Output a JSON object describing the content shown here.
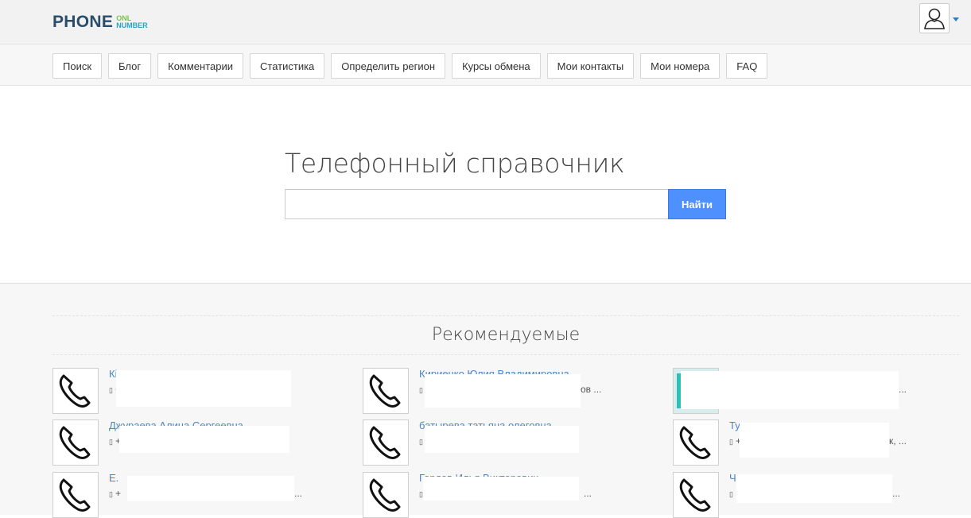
{
  "header": {
    "logo_main": "PHONE",
    "logo_sub_top": "ONL",
    "logo_sub_bottom": "NUMBER"
  },
  "nav": {
    "items": [
      {
        "label": "Поиск"
      },
      {
        "label": "Блог"
      },
      {
        "label": "Комментарии"
      },
      {
        "label": "Статистика"
      },
      {
        "label": "Определить регион"
      },
      {
        "label": "Курсы обмена"
      },
      {
        "label": "Мои контакты"
      },
      {
        "label": "Мои номера"
      },
      {
        "label": "FAQ"
      }
    ]
  },
  "hero": {
    "title": "Телефонный справочник",
    "search_value": "",
    "search_button": "Найти"
  },
  "recommended": {
    "title": "Рекомендуемые",
    "cards": [
      {
        "name": "Кі",
        "phone": "+",
        "thumb": "phone-icon"
      },
      {
        "name": "Кириенко Юлия Владимировна",
        "phone": "",
        "tail": "ов ...",
        "thumb": "phone-icon"
      },
      {
        "name": "",
        "phone": "",
        "tail": "...",
        "thumb": "photo"
      },
      {
        "name": "Джураева Алина Сергеевна",
        "phone": "+",
        "thumb": "phone-icon"
      },
      {
        "name": "батырева татьяна олеговна",
        "phone": "",
        "thumb": "phone-icon"
      },
      {
        "name": "Ту",
        "phone": "+",
        "tail": "к, ...",
        "thumb": "phone-icon"
      },
      {
        "name": "Е.",
        "phone": "+",
        "tail": "...",
        "thumb": "phone-icon"
      },
      {
        "name": "Гордов Илья Викторович",
        "phone": "",
        "tail": "...",
        "thumb": "phone-icon"
      },
      {
        "name": "Ч",
        "phone": "",
        "tail": "...",
        "thumb": "phone-icon"
      }
    ]
  }
}
